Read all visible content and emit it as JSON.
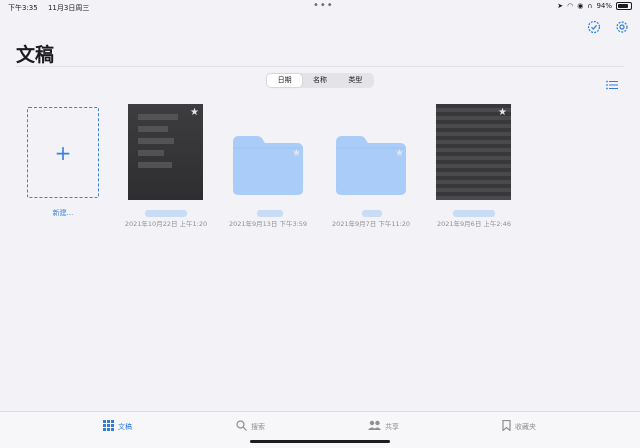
{
  "status": {
    "time": "下午3:35",
    "date": "11月3日周三",
    "battery": "94%"
  },
  "page_title": "文稿",
  "sort_tabs": [
    {
      "label": "日期"
    },
    {
      "label": "名称"
    },
    {
      "label": "类型"
    }
  ],
  "new_tile": {
    "label": "新建..."
  },
  "items": [
    {
      "kind": "document",
      "meta": "2021年10月22日 上午1:20"
    },
    {
      "kind": "folder",
      "meta": "2021年9月13日 下午3:59"
    },
    {
      "kind": "folder",
      "meta": "2021年9月7日 下午11:20"
    },
    {
      "kind": "document",
      "meta": "2021年9月6日 上午2:46"
    }
  ],
  "tabbar": [
    {
      "label": "文稿",
      "icon": "grid-icon",
      "active": true
    },
    {
      "label": "搜索",
      "icon": "search-icon",
      "active": false
    },
    {
      "label": "共享",
      "icon": "people-icon",
      "active": false
    },
    {
      "label": "收藏夹",
      "icon": "bookmark-icon",
      "active": false
    }
  ],
  "colors": {
    "accent": "#2f7de1",
    "folder": "#a9cdf8",
    "background": "#f2f2f7"
  }
}
